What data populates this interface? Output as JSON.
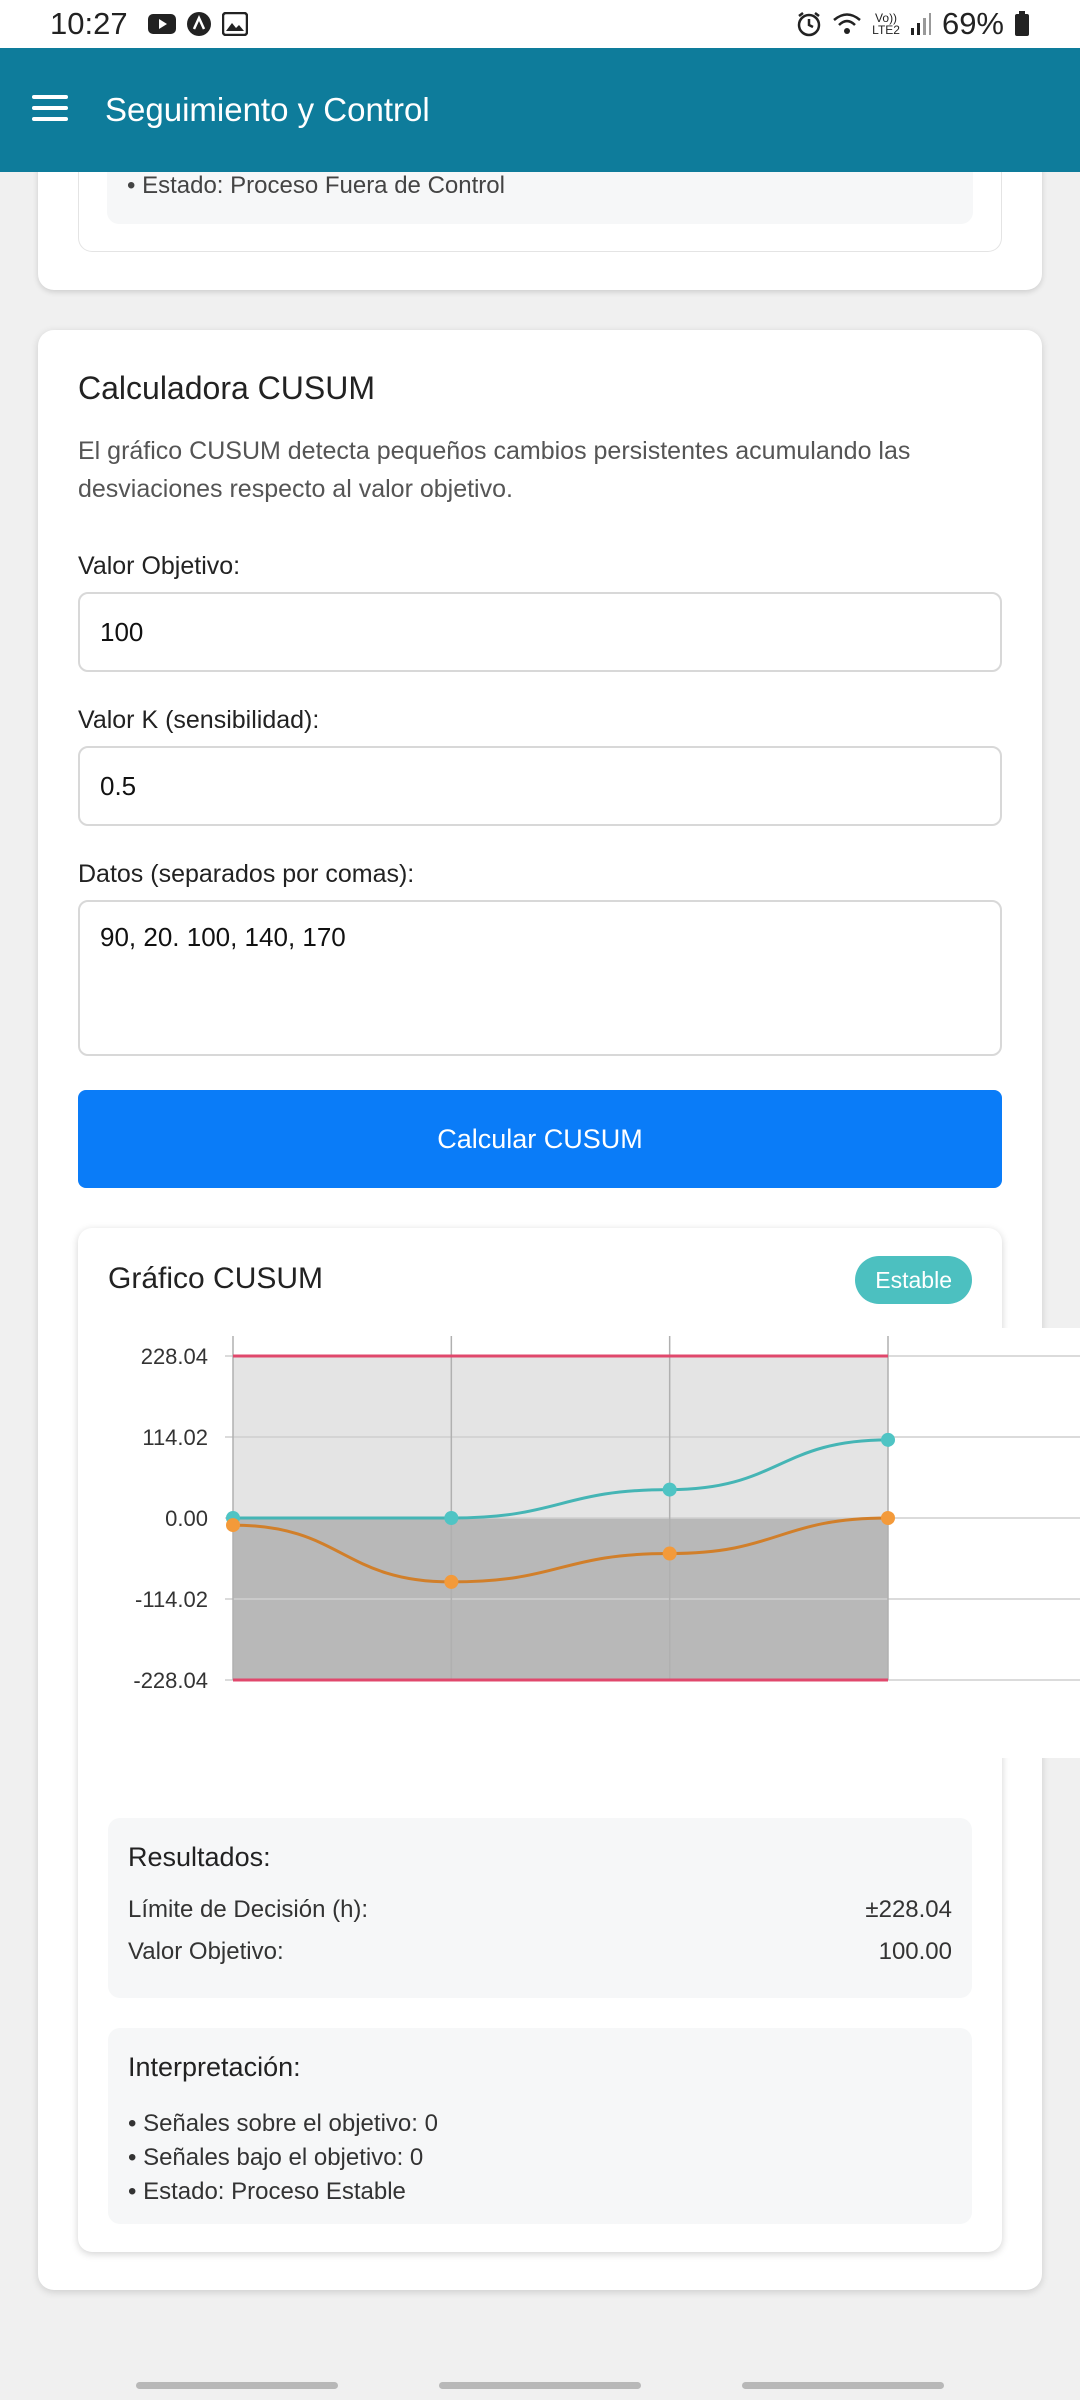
{
  "status_bar": {
    "time": "10:27",
    "battery": "69%",
    "icons_left": [
      "youtube-icon",
      "app-icon",
      "gallery-icon"
    ],
    "icons_right": [
      "alarm-icon",
      "wifi-icon",
      "volte-icon",
      "signal-icon",
      "battery-icon"
    ],
    "volte_label_top": "Vo))",
    "volte_label_bottom": "LTE2"
  },
  "app_bar": {
    "title": "Seguimiento y Control",
    "color": "#0e7c9b"
  },
  "previous_card": {
    "line": "• Estado: Proceso Fuera de Control"
  },
  "cusum": {
    "title": "Calculadora CUSUM",
    "description": "El gráfico CUSUM detecta pequeños cambios persistentes acumulando las desviaciones respecto al valor objetivo.",
    "target_label": "Valor Objetivo:",
    "target_value": "100",
    "k_label": "Valor K (sensibilidad):",
    "k_value": "0.5",
    "data_label": "Datos (separados por comas):",
    "data_value": "90, 20. 100, 140, 170",
    "button_label": "Calcular CUSUM",
    "button_color": "#0a7cf8"
  },
  "chart_card": {
    "title": "Gráfico CUSUM",
    "badge": "Estable",
    "badge_color": "#4cc0c0"
  },
  "chart_data": {
    "type": "line",
    "x": [
      0,
      1,
      2,
      3
    ],
    "ylim": [
      -228.04,
      228.04
    ],
    "y_ticks": [
      "228.04",
      "114.02",
      "0.00",
      "-114.02",
      "-228.04"
    ],
    "y_tick_values": [
      228.04,
      114.02,
      0,
      -114.02,
      -228.04
    ],
    "series": [
      {
        "values": [
          0,
          0,
          40,
          110
        ],
        "color": "#45b5b5"
      },
      {
        "values": [
          -10,
          -90,
          -50,
          0
        ],
        "color": "#d17f2a"
      }
    ],
    "limit_lines": [
      228.04,
      -228.04
    ],
    "limit_color": "#e0486c",
    "grid": true
  },
  "results": {
    "title": "Resultados:",
    "rows": [
      {
        "label": "Límite de Decisión (h):",
        "value": "±228.04"
      },
      {
        "label": "Valor Objetivo:",
        "value": "100.00"
      }
    ]
  },
  "interpretation": {
    "title": "Interpretación:",
    "lines": [
      "• Señales sobre el objetivo: 0",
      "• Señales bajo el objetivo: 0",
      "• Estado: Proceso Estable"
    ]
  }
}
